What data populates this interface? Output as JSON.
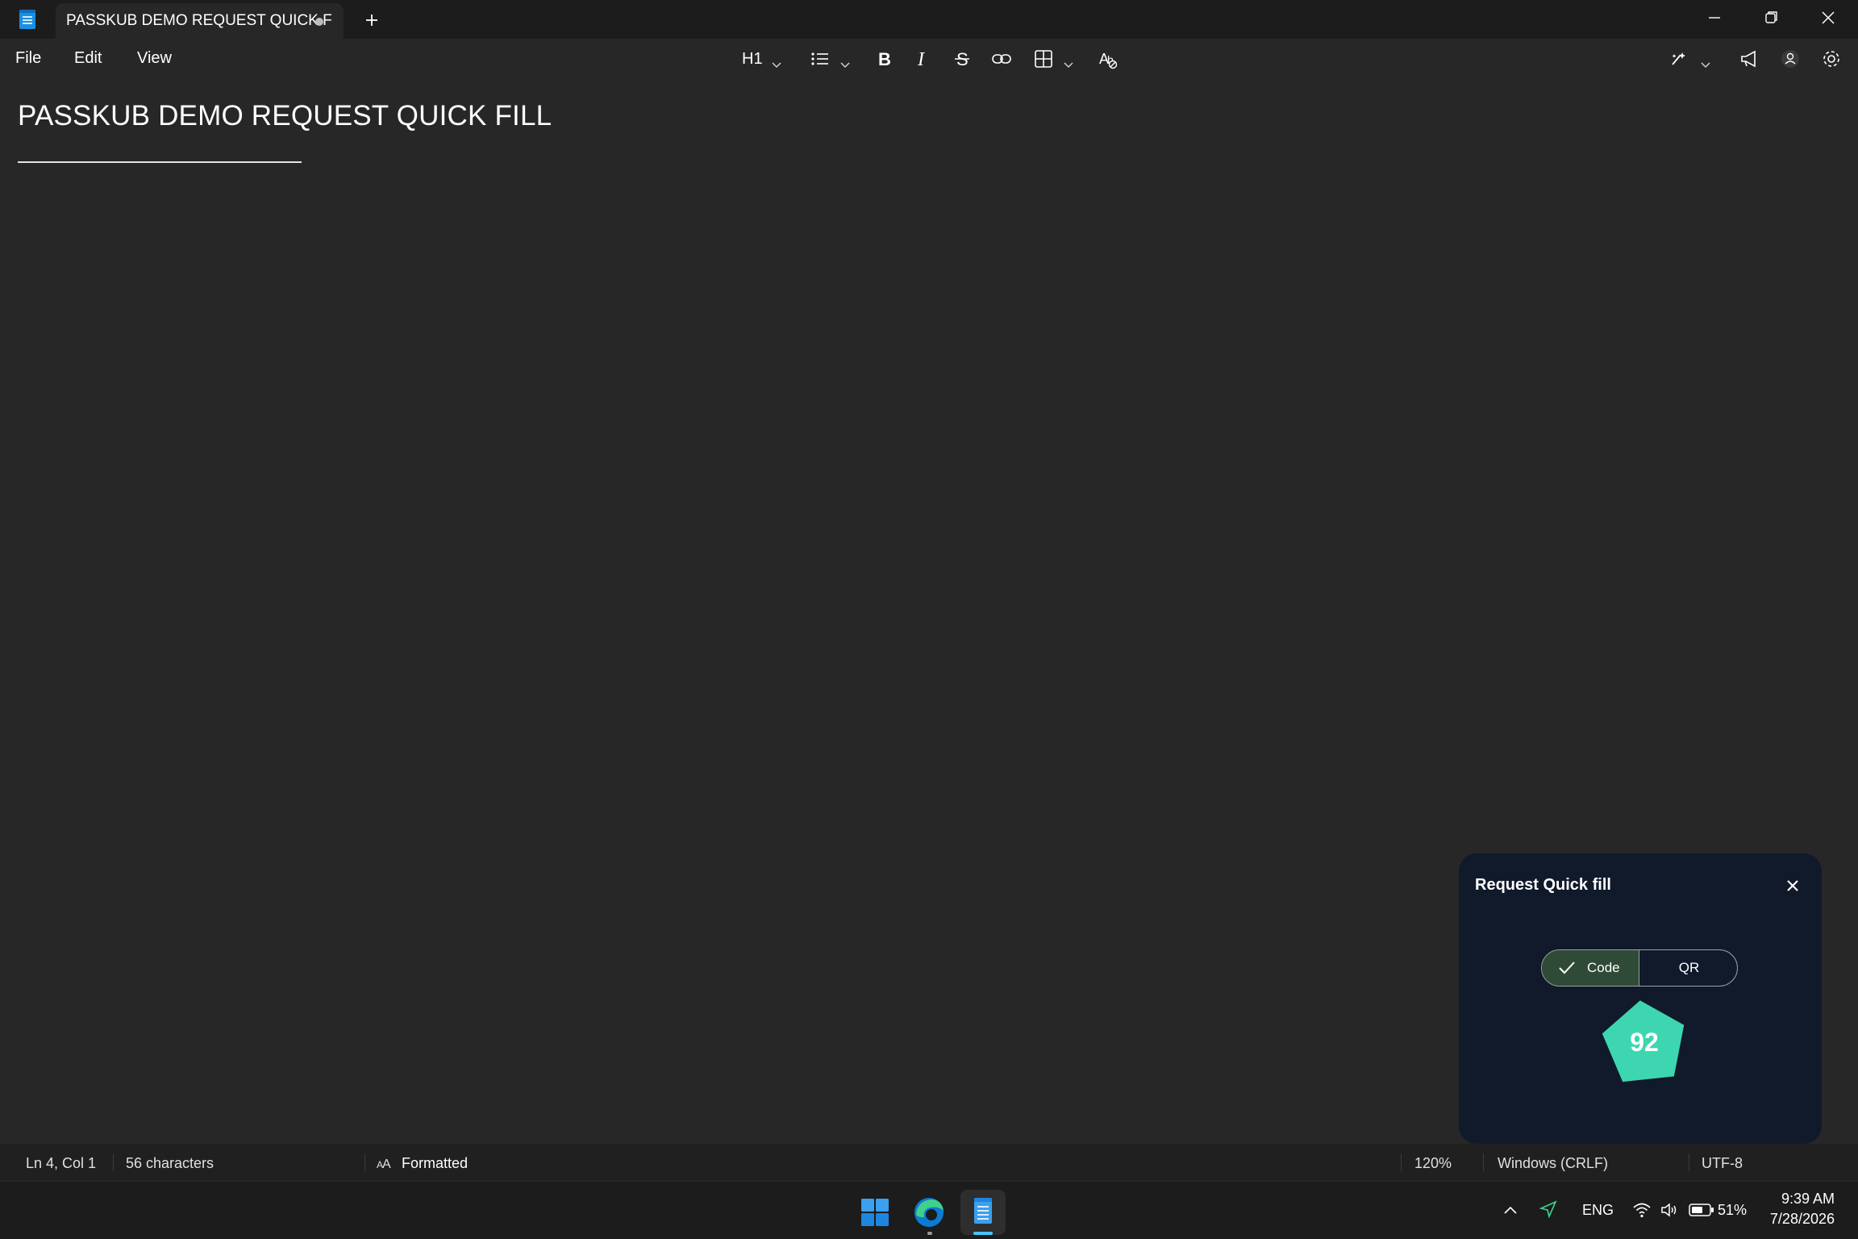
{
  "window": {
    "tab_title": "PASSKUB DEMO REQUEST QUICK F",
    "new_tab_label": "+"
  },
  "menu": {
    "file": "File",
    "edit": "Edit",
    "view": "View"
  },
  "toolbar": {
    "heading_level": "H1"
  },
  "document": {
    "heading": "PASSKUB DEMO REQUEST QUICK FILL"
  },
  "popup": {
    "title": "Request Quick fill",
    "segments": [
      "Code",
      "QR"
    ],
    "selected_segment": "Code",
    "code_value": "92",
    "badge_color": "#3dd6b0"
  },
  "statusbar": {
    "position": "Ln 4, Col 1",
    "characters": "56 characters",
    "format": "Formatted",
    "zoom": "120%",
    "line_ending": "Windows (CRLF)",
    "encoding": "UTF-8"
  },
  "taskbar": {
    "apps": [
      "start-icon",
      "edge-icon",
      "notepad-icon"
    ],
    "language": "ENG",
    "battery": "51%",
    "time": "9:39 AM",
    "date": "7/28/2026"
  },
  "colors": {
    "editor_bg": "#272727",
    "titlebar_bg": "#1c1c1c",
    "popup_bg": "#111a2b",
    "accent_green": "#2f4a37"
  }
}
